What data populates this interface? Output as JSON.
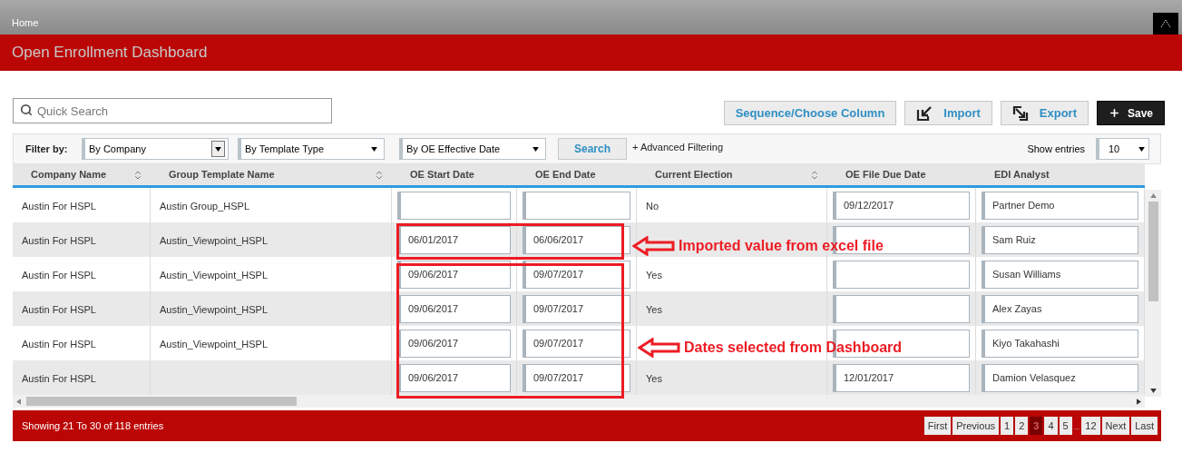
{
  "breadcrumb": "Home",
  "header": {
    "title": "Open Enrollment Dashboard"
  },
  "search": {
    "placeholder": "Quick Search"
  },
  "actions": [
    {
      "kind": "plain",
      "label": "Sequence/Choose Column"
    },
    {
      "kind": "import",
      "label": "Import"
    },
    {
      "kind": "export",
      "label": "Export"
    },
    {
      "kind": "save",
      "label": "Save"
    }
  ],
  "filters": {
    "label": "Filter by:",
    "selects": [
      {
        "value": "By Company",
        "kind": "boxed"
      },
      {
        "value": "By Template Type",
        "kind": "plain"
      },
      {
        "value": "By OE Effective Date",
        "kind": "plain"
      }
    ],
    "search_button": "Search",
    "advanced": "+ Advanced Filtering",
    "show_entries": {
      "label": "Show entries",
      "value": "10"
    }
  },
  "table": {
    "columns": [
      {
        "label": "Company Name",
        "sortable": true,
        "kind": "text"
      },
      {
        "label": "Group Template Name",
        "sortable": true,
        "kind": "text"
      },
      {
        "label": "OE Start Date",
        "sortable": false,
        "kind": "input"
      },
      {
        "label": "OE End Date",
        "sortable": false,
        "kind": "input"
      },
      {
        "label": "Current Election",
        "sortable": true,
        "kind": "text"
      },
      {
        "label": "OE File Due Date",
        "sortable": false,
        "kind": "input"
      },
      {
        "label": "EDI Analyst",
        "sortable": false,
        "kind": "input"
      }
    ],
    "rows": [
      [
        "Austin For HSPL",
        "Austin Group_HSPL",
        null,
        null,
        "No",
        "09/12/2017",
        "Partner Demo"
      ],
      [
        "Austin For HSPL",
        "Austin_Viewpoint_HSPL",
        "06/01/2017",
        "06/06/2017",
        null,
        null,
        "Sam Ruiz"
      ],
      [
        "Austin For HSPL",
        "Austin_Viewpoint_HSPL",
        "09/06/2017",
        "09/07/2017",
        "Yes",
        null,
        "Susan Williams"
      ],
      [
        "Austin For HSPL",
        "Austin_Viewpoint_HSPL",
        "09/06/2017",
        "09/07/2017",
        "Yes",
        null,
        "Alex Zayas"
      ],
      [
        "Austin For HSPL",
        "Austin_Viewpoint_HSPL",
        "09/06/2017",
        "09/07/2017",
        null,
        null,
        "Kiyo Takahashi"
      ],
      [
        "Austin For HSPL",
        null,
        "09/06/2017",
        "09/07/2017",
        "Yes",
        "12/01/2017",
        "Damion Velasquez"
      ]
    ]
  },
  "footer": {
    "summary": "Showing 21 To 30 of 118 entries",
    "pages": [
      {
        "label": "First",
        "kind": "page",
        "selected": false
      },
      {
        "label": "Previous",
        "kind": "page",
        "selected": false
      },
      {
        "label": "1",
        "kind": "page",
        "selected": false
      },
      {
        "label": "2",
        "kind": "page",
        "selected": false
      },
      {
        "label": "3",
        "kind": "page",
        "selected": true
      },
      {
        "label": "4",
        "kind": "page",
        "selected": false
      },
      {
        "label": "5",
        "kind": "page",
        "selected": false
      },
      {
        "label": "...",
        "kind": "ellipsis"
      },
      {
        "label": "12",
        "kind": "page",
        "selected": false
      },
      {
        "label": "Next",
        "kind": "page",
        "selected": false
      },
      {
        "label": "Last",
        "kind": "page",
        "selected": false
      }
    ]
  },
  "annotations": [
    {
      "label": "Imported value from excel file"
    },
    {
      "label": "Dates selected from Dashboard"
    }
  ]
}
